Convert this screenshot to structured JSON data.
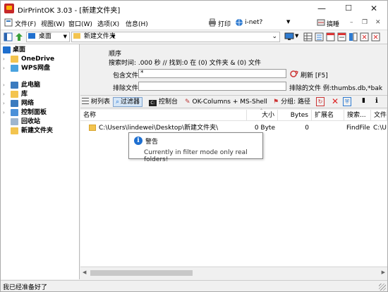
{
  "window": {
    "title": "DirPrintOK 3.03 - [新建文件夹]",
    "controls": {
      "minimize": "—",
      "maximize": "☐",
      "close": "✕"
    }
  },
  "menu": {
    "file": "文件(F)",
    "view": "视图(W)",
    "window": "窗口(W)",
    "options": "选项(X)",
    "info": "信息(H)",
    "print": "打印",
    "inet": "i-net?",
    "scan": "搞睡"
  },
  "address": {
    "location": "桌面",
    "folder": "新建文件夹"
  },
  "tree": {
    "items": [
      {
        "label": "桌面",
        "icon": "desktop-icon",
        "color": "#1f6fce"
      },
      {
        "label": "OneDrive",
        "icon": "onedrive-folder-icon",
        "color": "#f3c44f"
      },
      {
        "label": "WPS网盘",
        "icon": "cloud-icon",
        "color": "#4aa3df"
      },
      {
        "label": "此电脑",
        "icon": "computer-icon",
        "color": "#3b7bbf"
      },
      {
        "label": "库",
        "icon": "library-icon",
        "color": "#f3c44f"
      },
      {
        "label": "网络",
        "icon": "network-icon",
        "color": "#3b7bbf"
      },
      {
        "label": "控制面板",
        "icon": "control-panel-icon",
        "color": "#4a90d9"
      },
      {
        "label": "回收站",
        "icon": "recycle-bin-icon",
        "color": "#9fb6cf"
      },
      {
        "label": "新建文件夹",
        "icon": "folder-icon",
        "color": "#f3c44f"
      }
    ]
  },
  "filter": {
    "sort_label": "顺序",
    "search_info": "搜索时间: .000 秒 // 找到:0 在 (0) 文件夹 & (0) 文件",
    "include_label": "包含文件",
    "include_value": "*",
    "refresh_label": "刷新 [F5]",
    "exclude_label": "排除文件",
    "exclude_value": "",
    "exclude_hint": "排除的文件 例:thumbs.db,*bak"
  },
  "tabs": {
    "tree_list": "树列表",
    "filter": "过滤器",
    "console": "控制台",
    "ok_columns": "OK-Columns + MS-Shell",
    "group": "分组: 路径"
  },
  "table": {
    "columns": [
      "名称",
      "大小",
      "Bytes",
      "扩展名",
      "搜索...",
      "文件"
    ],
    "rows": [
      {
        "name": "C:\\Users\\lindewei\\Desktop\\新建文件夹\\",
        "size": "0 Byte",
        "bytes": "0",
        "ext": "",
        "search": "FindFile",
        "file": "C:\\U"
      }
    ]
  },
  "tooltip": {
    "title": "警告",
    "message": "Currently in filter mode only real folders!"
  },
  "status": {
    "text": "我已经准备好了"
  }
}
